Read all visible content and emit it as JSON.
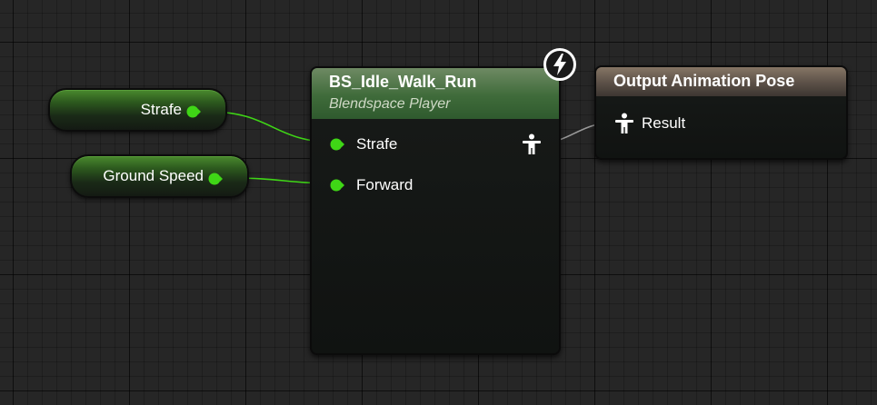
{
  "variables": [
    {
      "label": "Strafe"
    },
    {
      "label": "Ground Speed"
    }
  ],
  "blendspace_node": {
    "title": "BS_Idle_Walk_Run",
    "subtitle": "Blendspace Player",
    "inputs": [
      {
        "label": "Strafe"
      },
      {
        "label": "Forward"
      }
    ],
    "output_icon": "pose-figure-icon",
    "badge_icon": "lightning-bolt-icon"
  },
  "output_node": {
    "title": "Output Animation Pose",
    "input_label": "Result",
    "input_icon": "pose-figure-icon"
  },
  "colors": {
    "float_pin": "#3fd616",
    "pose_wire": "#9a9a9a",
    "blendspace_header": "#3f6b3a",
    "output_header": "#5b5047"
  }
}
